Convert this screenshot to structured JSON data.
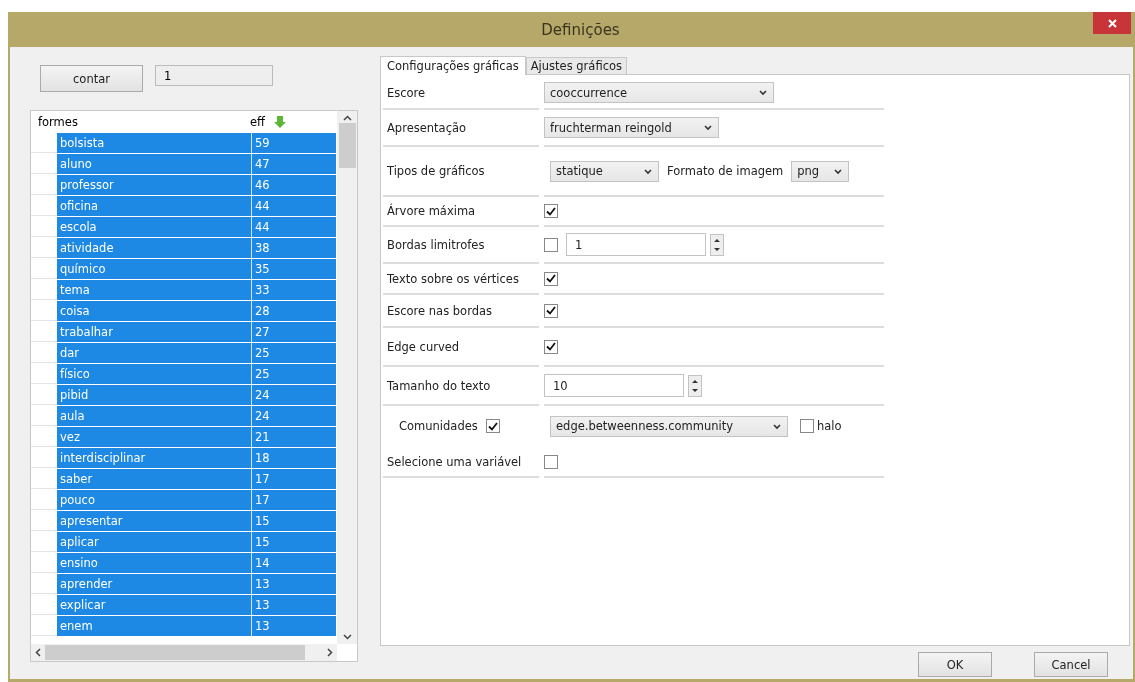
{
  "window": {
    "title": "Definições"
  },
  "counter": {
    "button": "contar",
    "value": "1"
  },
  "table": {
    "columns": [
      "formes",
      "eff"
    ],
    "rows": [
      {
        "cells": [
          "bolsista",
          "59"
        ],
        "selected": true
      },
      {
        "cells": [
          "aluno",
          "47"
        ],
        "selected": true
      },
      {
        "cells": [
          "professor",
          "46"
        ],
        "selected": true
      },
      {
        "cells": [
          "oficina",
          "44"
        ],
        "selected": true
      },
      {
        "cells": [
          "escola",
          "44"
        ],
        "selected": true
      },
      {
        "cells": [
          "atividade",
          "38"
        ],
        "selected": true
      },
      {
        "cells": [
          "químico",
          "35"
        ],
        "selected": true
      },
      {
        "cells": [
          "tema",
          "33"
        ],
        "selected": true
      },
      {
        "cells": [
          "coisa",
          "28"
        ],
        "selected": true
      },
      {
        "cells": [
          "trabalhar",
          "27"
        ],
        "selected": true
      },
      {
        "cells": [
          "dar",
          "25"
        ],
        "selected": true
      },
      {
        "cells": [
          "físico",
          "25"
        ],
        "selected": true
      },
      {
        "cells": [
          "pibid",
          "24"
        ],
        "selected": true
      },
      {
        "cells": [
          "aula",
          "24"
        ],
        "selected": true
      },
      {
        "cells": [
          "vez",
          "21"
        ],
        "selected": true
      },
      {
        "cells": [
          "interdisciplinar",
          "18"
        ],
        "selected": true
      },
      {
        "cells": [
          "saber",
          "17"
        ],
        "selected": true
      },
      {
        "cells": [
          "pouco",
          "17"
        ],
        "selected": true
      },
      {
        "cells": [
          "apresentar",
          "15"
        ],
        "selected": true
      },
      {
        "cells": [
          "aplicar",
          "15"
        ],
        "selected": true
      },
      {
        "cells": [
          "ensino",
          "14"
        ],
        "selected": true
      },
      {
        "cells": [
          "aprender",
          "13"
        ],
        "selected": true
      },
      {
        "cells": [
          "explicar",
          "13"
        ],
        "selected": true
      },
      {
        "cells": [
          "enem",
          "13"
        ],
        "selected": true
      }
    ]
  },
  "tabs": [
    {
      "label": "Configurações gráficas",
      "selected": true
    },
    {
      "label": "Ajustes gráficos",
      "selected": false
    }
  ],
  "settings": [
    {
      "kind": "select",
      "label": "Escore",
      "value": "cooccurrence"
    },
    {
      "kind": "select",
      "label": "Apresentação",
      "value": "fruchterman reingold"
    },
    {
      "kind": "select-pair",
      "label": "Tipos de gráficos",
      "value": "statique",
      "label2": "Formato de imagem",
      "value2": "png"
    },
    {
      "kind": "checkbox",
      "label": "Árvore máxima",
      "checked": true
    },
    {
      "kind": "check-spin",
      "label": "Bordas limitrofes",
      "checked": false,
      "value": "1"
    },
    {
      "kind": "checkbox",
      "label": "Texto sobre os vértices",
      "checked": true
    },
    {
      "kind": "checkbox",
      "label": "Escore nas bordas",
      "checked": true
    },
    {
      "kind": "checkbox",
      "label": "Edge curved",
      "checked": true
    },
    {
      "kind": "spin",
      "label": "Tamanho do texto",
      "value": "10"
    },
    {
      "kind": "community",
      "label": "Comunidades",
      "checked": true,
      "value": "edge.betweenness.community",
      "option_label": "halo",
      "option_checked": false
    },
    {
      "kind": "checkbox",
      "label": "Selecione uma variável",
      "checked": false
    }
  ],
  "buttons": [
    "OK",
    "Cancel"
  ]
}
